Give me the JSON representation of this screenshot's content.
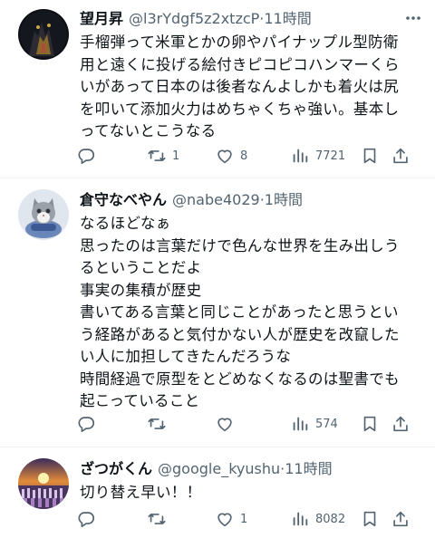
{
  "tweets": [
    {
      "name": "望月昇",
      "handle": "@l3rYdgf5z2xtzcP",
      "dot": "·",
      "time": "11時間",
      "lines": [
        "手榴弾って米軍とかの卵やパイナップル型防衛",
        "用と遠くに投げる絵付きピコピコハンマーくら",
        "いがあって日本のは後者なんよしかも着火は尻",
        "を叩いて添加火力はめちゃくちゃ強い。基本し",
        "ってないとこうなる"
      ],
      "retweets": "1",
      "likes": "8",
      "views": "7721"
    },
    {
      "name": "倉守なべやん",
      "handle": "@nabe4029",
      "dot": "·",
      "time": "1時間",
      "lines": [
        "なるほどなぁ",
        "思ったのは言葉だけで色んな世界を生み出しう",
        "るということだよ",
        "事実の集積が歴史",
        "書いてある言葉と同じことがあったと思うとい",
        "う経路があると気付かない人が歴史を改竄した",
        "い人に加担してきたんだろうな",
        "時間経過で原型をとどめなくなるのは聖書でも",
        "起こっていること"
      ],
      "retweets": "",
      "likes": "",
      "views": "574"
    },
    {
      "name": "ざつがくん",
      "handle": "@google_kyushu",
      "dot": "·",
      "time": "11時間",
      "lines": [
        "切り替え早い！！"
      ],
      "retweets": "",
      "likes": "1",
      "views": "8082"
    }
  ],
  "icons": {
    "reply": "reply-icon",
    "retweet": "retweet-icon",
    "like": "heart-icon",
    "views": "views-icon",
    "bookmark": "bookmark-icon",
    "share": "share-icon",
    "more": "more-icon"
  },
  "colors": {
    "text": "#0f1419",
    "secondary": "#536471",
    "divider": "#eff3f4"
  }
}
